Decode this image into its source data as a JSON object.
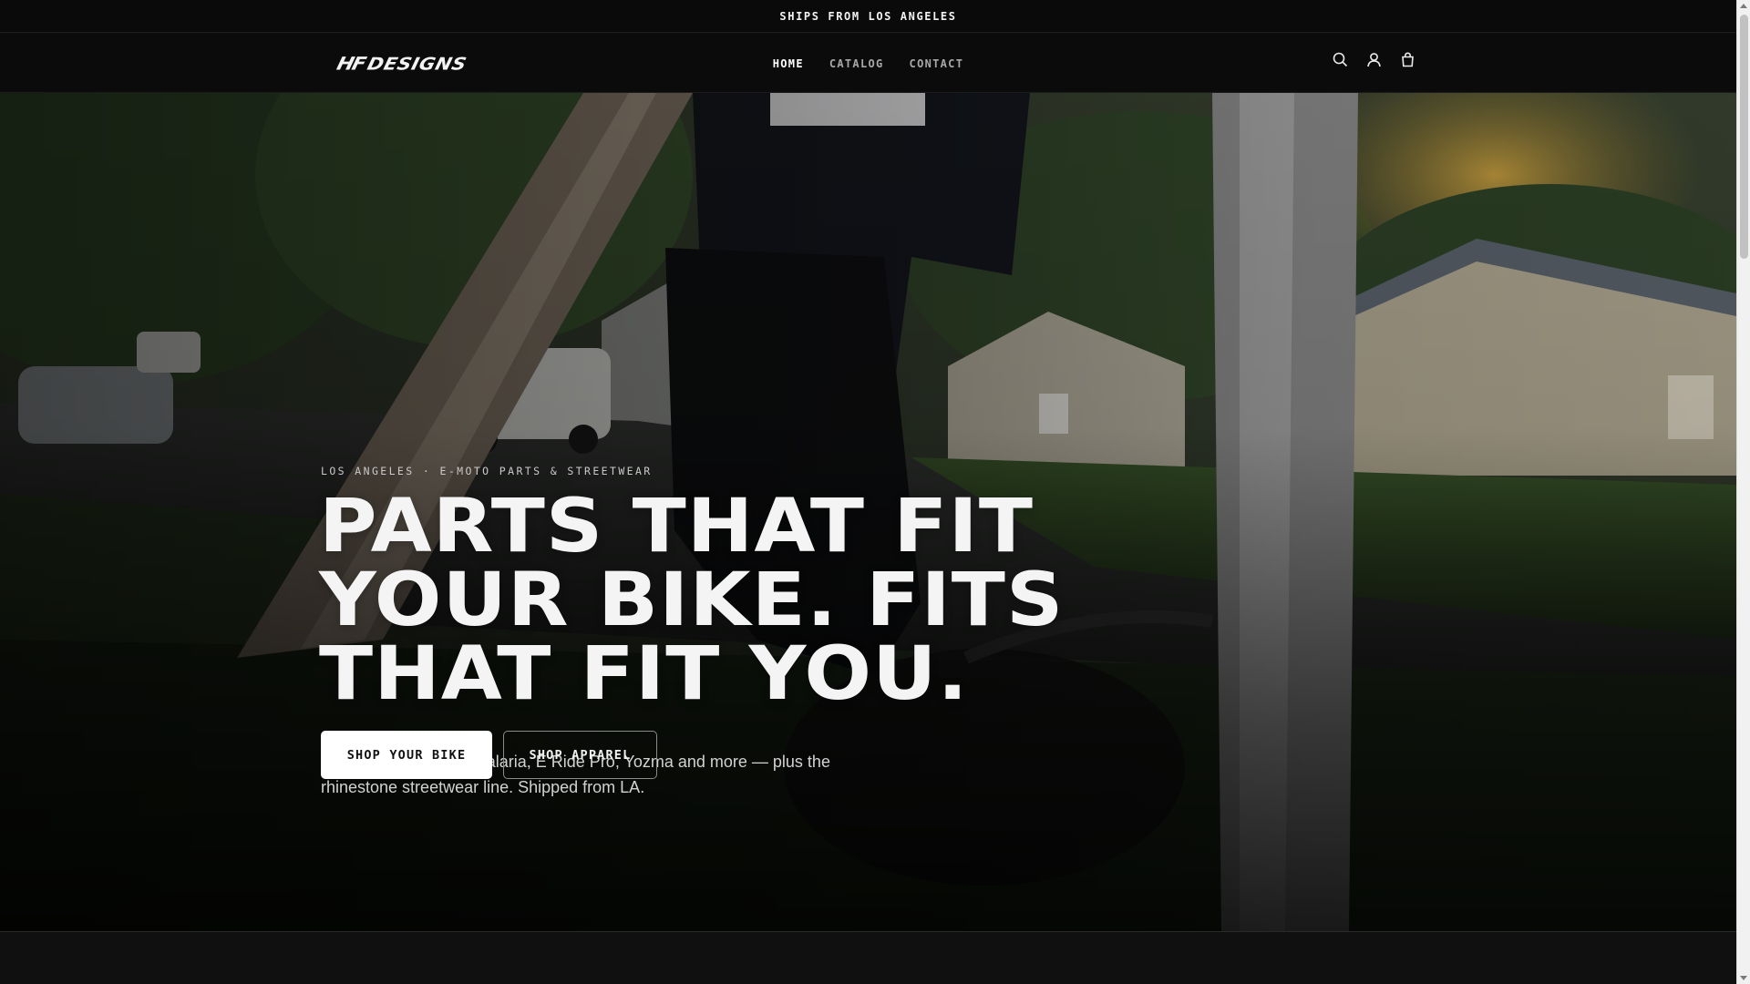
{
  "announcement": {
    "text": "SHIPS FROM LOS ANGELES"
  },
  "header": {
    "logo_mark": "HF",
    "logo_text": "DESIGNS",
    "nav": [
      {
        "label": "HOME",
        "active": true
      },
      {
        "label": "CATALOG",
        "active": false
      },
      {
        "label": "CONTACT",
        "active": false
      }
    ],
    "icons": [
      "search-icon",
      "account-icon",
      "cart-icon"
    ]
  },
  "hero": {
    "eyebrow": "LOS ANGELES · E-MOTO PARTS & STREETWEAR",
    "headline_lines": [
      "PARTS THAT FIT",
      "YOUR BIKE. FITS",
      "THAT FIT YOU."
    ],
    "subcopy": "Upgrades for Surron, Talaria, E Ride Pro, Yozma and more — plus the rhinestone streetwear line. Shipped from LA.",
    "buttons": {
      "primary": "SHOP YOUR BIKE",
      "secondary": "SHOP APPAREL"
    }
  },
  "colors": {
    "bar_background": "#0a0a0a",
    "nav_active": "#ffffff",
    "nav_inactive": "#a8a8a8",
    "primary_button_bg": "#ffffff",
    "primary_button_text": "#111111"
  }
}
